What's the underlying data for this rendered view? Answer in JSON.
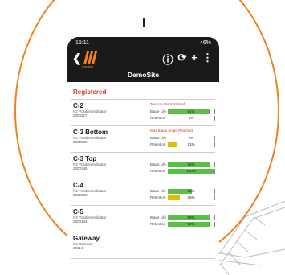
{
  "status": {
    "time": "15:11",
    "battery": "46%"
  },
  "app": {
    "brand": "manitou",
    "title": "DemoSite"
  },
  "section": "Registered",
  "items": [
    {
      "name": "C-2",
      "type": "N2 Position Indicator",
      "serial": "2000227",
      "alert": "Tension Point Passed",
      "blade": {
        "label": "Blade Life",
        "value": 91,
        "text": "91%",
        "color": "#5cbf47"
      },
      "retention": {
        "label": "Retention",
        "value": 0,
        "text": "0%",
        "color": "#5cbf47"
      }
    },
    {
      "name": "C-3 Bottom",
      "type": "N2 Position Indicator",
      "serial": "2000068",
      "alert": "Max Blade Angle Reached",
      "blade": {
        "label": "Blade Life",
        "value": 0,
        "text": "0%",
        "color": "#5cbf47"
      },
      "retention": {
        "label": "Retention",
        "value": 21,
        "text": "21%",
        "color": "#d6c200"
      }
    },
    {
      "name": "C-3 Top",
      "type": "N2 Position Indicator",
      "serial": "2000148",
      "alert": "",
      "blade": {
        "label": "Blade Life",
        "value": 92,
        "text": "92%",
        "color": "#5cbf47"
      },
      "retention": {
        "label": "Retention",
        "value": 100,
        "text": "100%",
        "color": "#5cbf47"
      }
    },
    {
      "name": "C-4",
      "type": "N2 Position Indicator",
      "serial": "2000062",
      "alert": "",
      "blade": {
        "label": "Blade Life",
        "value": 52,
        "text": "52%",
        "color": "#5cbf47"
      },
      "retention": {
        "label": "Retention",
        "value": 25,
        "text": "25%",
        "color": "#d6c200"
      }
    },
    {
      "name": "C-5",
      "type": "N2 Position Indicator",
      "serial": "2000134",
      "alert": "",
      "blade": {
        "label": "Blade Life",
        "value": 90,
        "text": "90%",
        "color": "#5cbf47"
      },
      "retention": {
        "label": "Retention",
        "value": 92,
        "text": "92%",
        "color": "#5cbf47"
      }
    },
    {
      "name": "Gateway",
      "type": "N2 Gateway",
      "serial": "20114",
      "alert": "",
      "blade": null,
      "retention": null
    }
  ],
  "icons": {
    "back": "back-arrow-icon",
    "info": "info-icon",
    "refresh": "refresh-icon",
    "add": "plus-icon",
    "menu": "more-vert-icon"
  },
  "colors": {
    "accent": "#f0821e",
    "alert": "#d83a2a",
    "good": "#5cbf47",
    "warn": "#d6c200"
  }
}
